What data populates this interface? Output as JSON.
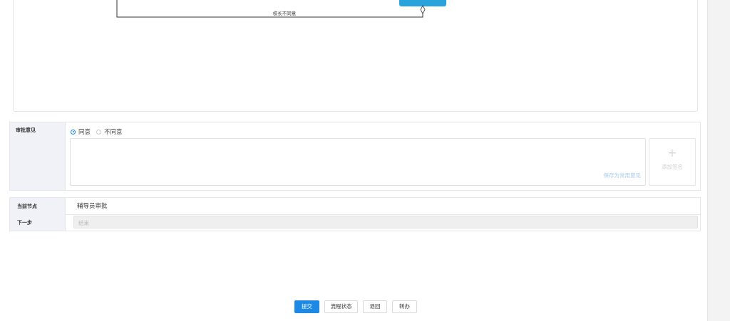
{
  "flow": {
    "edge_label": "校长不同意"
  },
  "opinion": {
    "label": "审批意见",
    "options": [
      {
        "label": "同意",
        "selected": true
      },
      {
        "label": "不同意",
        "selected": false
      }
    ],
    "save_common_label": "保存为常用意见",
    "add_sign_label": "添加签名",
    "add_icon": "plus-icon"
  },
  "info": {
    "current_node_label": "当前节点",
    "current_node_value": "辅导员审批",
    "next_step_label": "下一步",
    "next_step_value": "结束"
  },
  "actions": {
    "submit": "提交",
    "flow_status": "流程状态",
    "return": "退回",
    "transfer": "转办"
  },
  "colors": {
    "accent": "#1e88e5",
    "node_fill": "#29a3dc"
  }
}
